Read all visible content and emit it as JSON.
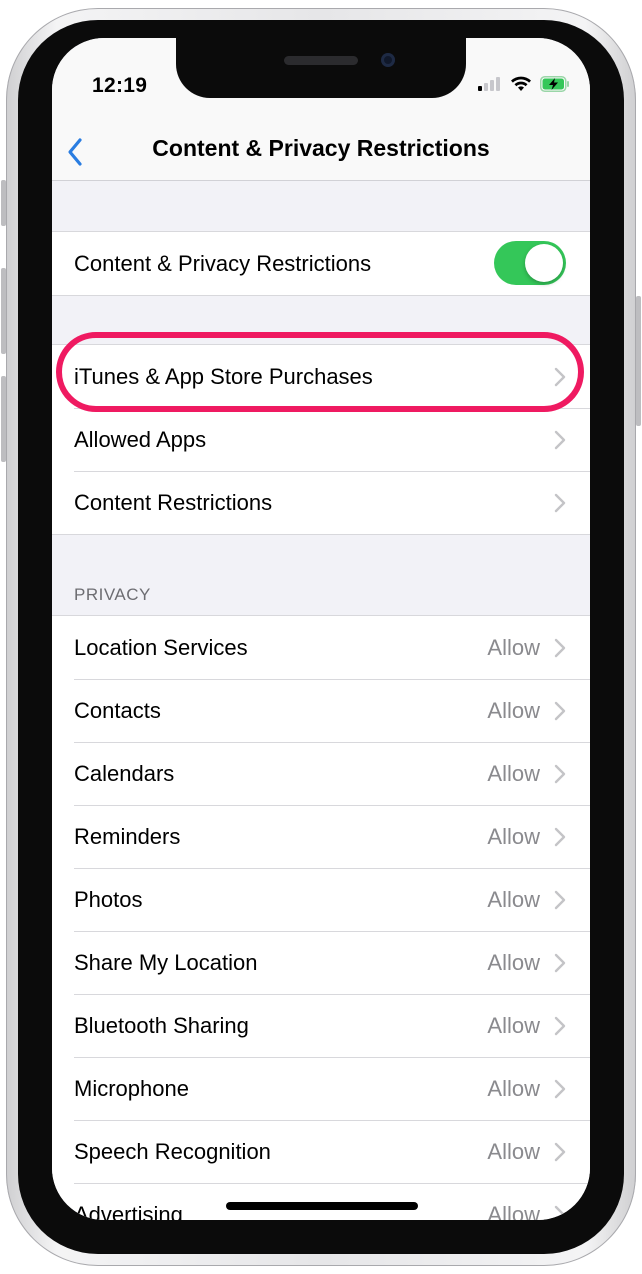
{
  "status_bar": {
    "time": "12:19",
    "signal_icon": "cellular-signal-icon",
    "wifi_icon": "wifi-icon",
    "battery_icon": "battery-charging-icon",
    "battery_color": "#34c759"
  },
  "nav": {
    "back_icon": "chevron-left-icon",
    "title": "Content & Privacy Restrictions",
    "accent_color": "#2a7de1"
  },
  "master_toggle": {
    "label": "Content & Privacy Restrictions",
    "state": "on",
    "color": "#34c759"
  },
  "store_group": {
    "items": [
      {
        "label": "iTunes & App Store Purchases",
        "highlighted": true
      },
      {
        "label": "Allowed Apps"
      },
      {
        "label": "Content Restrictions"
      }
    ]
  },
  "privacy": {
    "header": "PRIVACY",
    "items": [
      {
        "label": "Location Services",
        "value": "Allow"
      },
      {
        "label": "Contacts",
        "value": "Allow"
      },
      {
        "label": "Calendars",
        "value": "Allow"
      },
      {
        "label": "Reminders",
        "value": "Allow"
      },
      {
        "label": "Photos",
        "value": "Allow"
      },
      {
        "label": "Share My Location",
        "value": "Allow"
      },
      {
        "label": "Bluetooth Sharing",
        "value": "Allow"
      },
      {
        "label": "Microphone",
        "value": "Allow"
      },
      {
        "label": "Speech Recognition",
        "value": "Allow"
      },
      {
        "label": "Advertising",
        "value": "Allow"
      }
    ]
  },
  "annotation": {
    "highlight_color": "#ef1a61"
  }
}
